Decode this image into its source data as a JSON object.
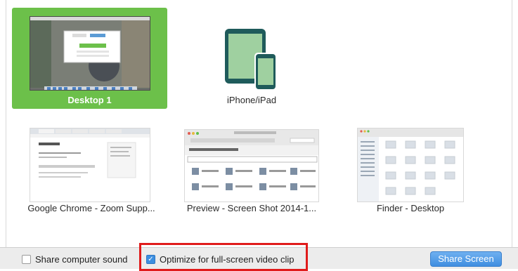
{
  "tiles": [
    {
      "label": "Desktop 1",
      "selected": true,
      "icon": "desktop-thumbnail"
    },
    {
      "label": "iPhone/iPad",
      "selected": false,
      "icon": "iphone-ipad-icon"
    },
    {
      "label": "Google Chrome - Zoom Supp...",
      "selected": false,
      "icon": "chrome-window-thumbnail"
    },
    {
      "label": "Preview - Screen Shot 2014-1...",
      "selected": false,
      "icon": "preview-window-thumbnail"
    },
    {
      "label": "Finder - Desktop",
      "selected": false,
      "icon": "finder-window-thumbnail"
    }
  ],
  "footer": {
    "share_sound_label": "Share computer sound",
    "share_sound_checked": false,
    "optimize_label": "Optimize for full-screen video clip",
    "optimize_checked": true,
    "share_button_label": "Share Screen"
  },
  "colors": {
    "selected_tile": "#6cc04a",
    "ipad_icon": "#1f5b5b",
    "ipad_screen": "#9fd0a0",
    "highlight_box": "#e01b1b",
    "share_button": "#3f8ee0"
  }
}
